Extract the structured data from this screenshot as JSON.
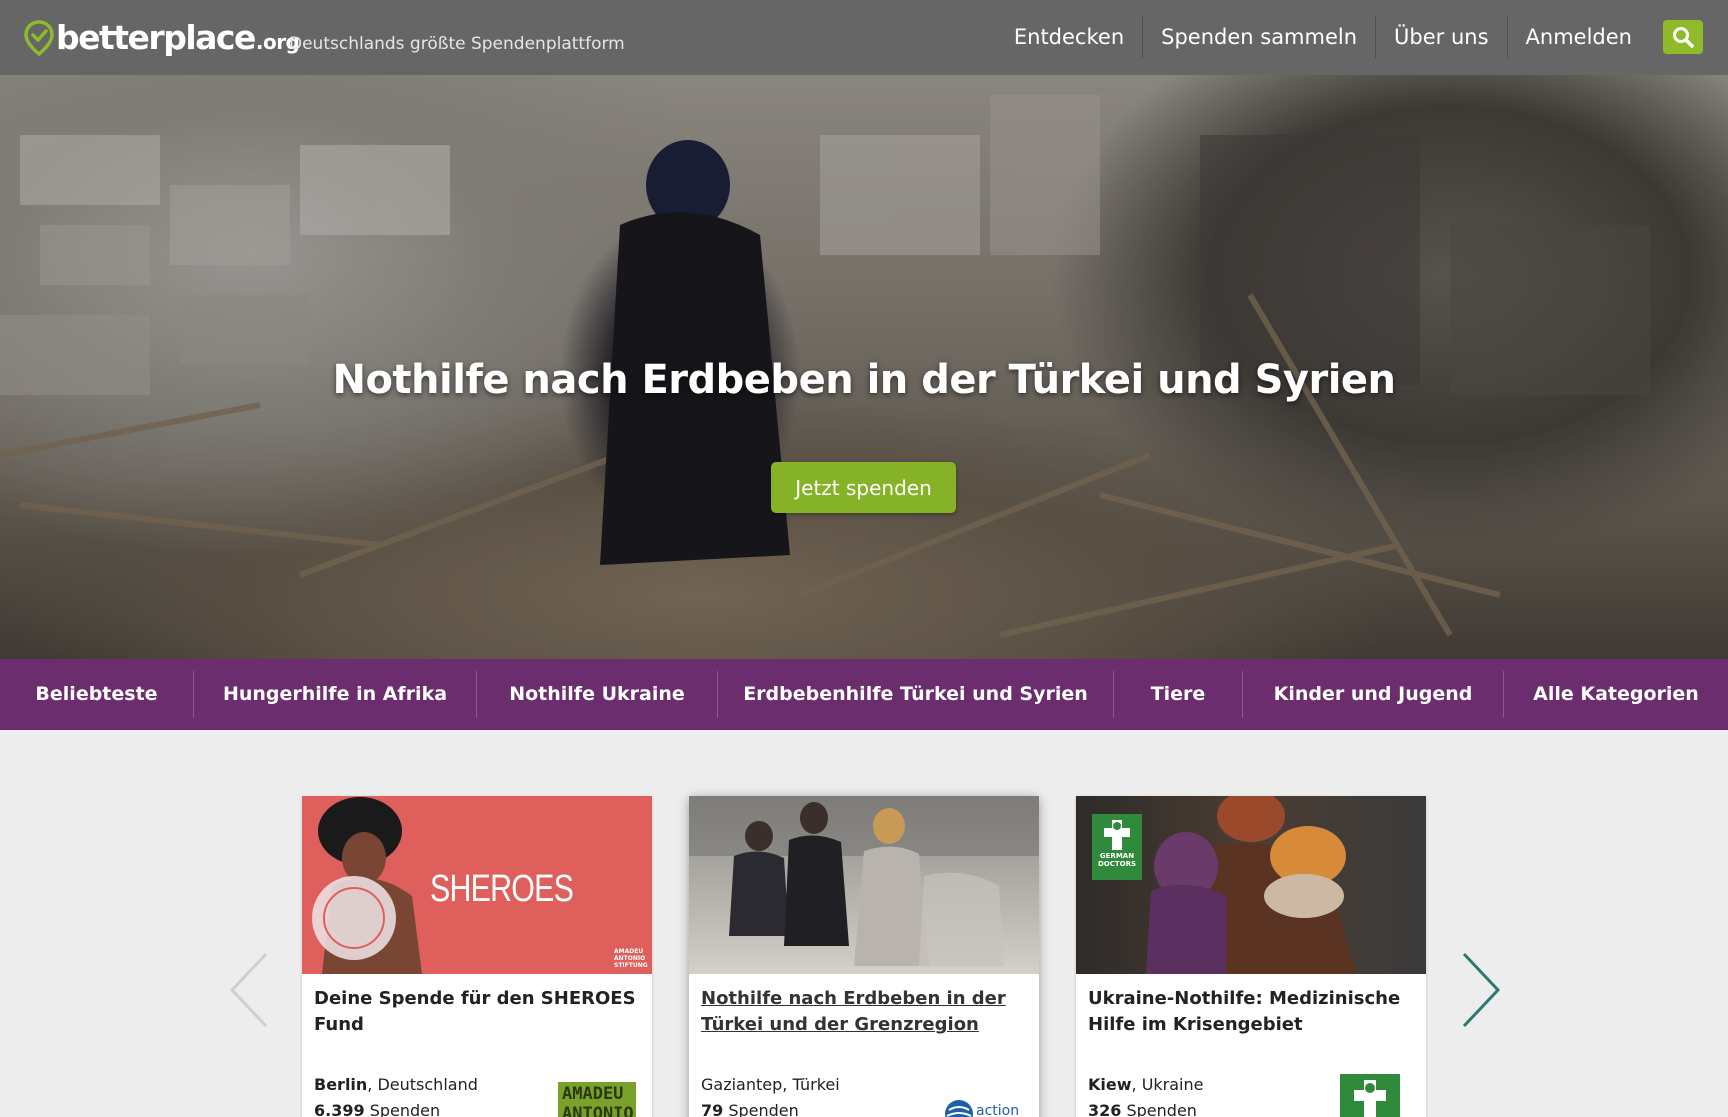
{
  "header": {
    "logo_name": "betterplace",
    "logo_suffix": ".org",
    "tagline": "Deutschlands größte Spendenplattform",
    "nav": [
      "Entdecken",
      "Spenden sammeln",
      "Über uns",
      "Anmelden"
    ],
    "brand_color": "#8fbb2a",
    "search_icon": "search-icon"
  },
  "hero": {
    "title": "Nothilfe nach Erdbeben in der Türkei und Syrien",
    "cta": "Jetzt spenden"
  },
  "categories": [
    "Beliebteste",
    "Hungerhilfe in Afrika",
    "Nothilfe Ukraine",
    "Erdbebenhilfe Türkei und Syrien",
    "Tiere",
    "Kinder und Jugend",
    "Alle Kategorien"
  ],
  "category_color": "#6b2d6d",
  "cards": [
    {
      "image_text": "SHEROES",
      "image_badge": "AMADEU ANTONIO STIFTUNG",
      "title": "Deine Spende für den SHEROES Fund",
      "city": "Berlin",
      "country": ", Deutschland",
      "count": "6.399",
      "count_label": " Spenden",
      "org_logo": "AMADEU ANTONIO"
    },
    {
      "title": "Nothilfe nach Erdbeben in der Türkei und der Grenzregion",
      "city": "Gaziantep",
      "country": ", Türkei",
      "count": "79",
      "count_label": " Spenden",
      "org_logo": "action"
    },
    {
      "image_badge": "GERMAN DOCTORS",
      "title": "Ukraine-Nothilfe: Medizinische Hilfe im Krisengebiet",
      "city": "Kiew",
      "country": ", Ukraine",
      "count": "326",
      "count_label": " Spenden"
    }
  ]
}
